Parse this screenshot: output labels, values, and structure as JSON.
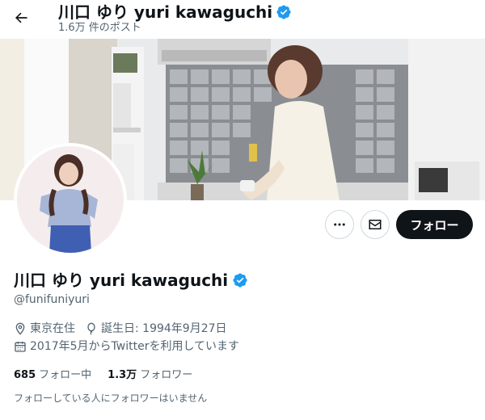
{
  "header": {
    "title": "川口 ゆり yuri kawaguchi",
    "post_count": "1.6万 件のポスト"
  },
  "profile": {
    "display_name": "川口 ゆり yuri kawaguchi",
    "handle": "@funifuniyuri",
    "location": "東京在住",
    "birthday": "誕生日: 1994年9月27日",
    "joined": "2017年5月からTwitterを利用しています",
    "following_count": "685",
    "following_label": "フォロー中",
    "followers_count": "1.3万",
    "followers_label": "フォロワー",
    "mutual_note": "フォローしている人にフォロワーはいません"
  },
  "actions": {
    "follow_label": "フォロー",
    "more_icon": "more-icon",
    "message_icon": "envelope-icon"
  },
  "icons": {
    "back": "arrow-left-icon",
    "verified": "verified-badge-icon",
    "location": "location-pin-icon",
    "birthday": "balloon-icon",
    "calendar": "calendar-icon"
  },
  "colors": {
    "verified_blue": "#1d9bf0",
    "follow_button_bg": "#0f1419",
    "secondary_text": "#536471"
  }
}
